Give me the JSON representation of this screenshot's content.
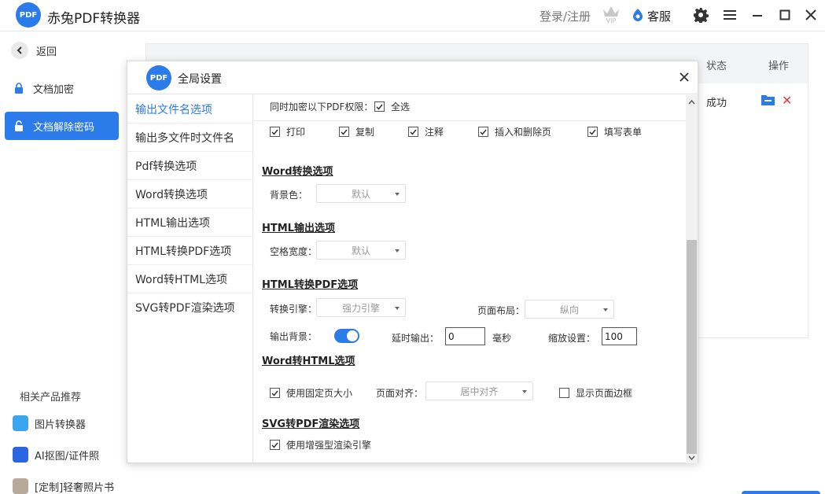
{
  "titlebar": {
    "logo_text": "PDF",
    "app_title": "赤兔PDF转换器",
    "login_label": "登录/注册",
    "vip_icon": "vip-crown-icon",
    "service_label": "客服"
  },
  "sidebar": {
    "back_label": "返回",
    "items": [
      {
        "label": "文档加密",
        "icon": "lock-icon",
        "active": false
      },
      {
        "label": "文档解除密码",
        "icon": "unlock-icon",
        "active": true
      }
    ],
    "related_title": "相关产品推荐",
    "products": [
      {
        "label": "图片转换器",
        "color": "#3aa6f0"
      },
      {
        "label": "AI抠图/证件照",
        "color": "#2b66e0"
      },
      {
        "label": "[定制]轻奢照片书",
        "color": "#b9a99a"
      }
    ]
  },
  "background_table": {
    "status_header": "状态",
    "action_header": "操作",
    "rows": [
      {
        "status": "成功"
      }
    ]
  },
  "dialog": {
    "logo_text": "PDF",
    "title": "全局设置",
    "menu": [
      {
        "label": "输出文件名选项",
        "active": true
      },
      {
        "label": "输出多文件时文件名",
        "active": false
      },
      {
        "label": "Pdf转换选项",
        "active": false
      },
      {
        "label": "Word转换选项",
        "active": false
      },
      {
        "label": "HTML输出选项",
        "active": false
      },
      {
        "label": "HTML转换PDF选项",
        "active": false
      },
      {
        "label": "Word转HTML选项",
        "active": false
      },
      {
        "label": "SVG转PDF渲染选项",
        "active": false
      }
    ],
    "permissions": {
      "label": "同时加密以下PDF权限：",
      "select_all": "全选",
      "items": [
        "打印",
        "复制",
        "注释",
        "插入和删除页",
        "填写表单"
      ]
    },
    "word_section": {
      "title": "Word转换选项",
      "bg_color_label": "背景色：",
      "bg_color_value": "默认"
    },
    "html_output_section": {
      "title": "HTML输出选项",
      "space_width_label": "空格宽度：",
      "space_width_value": "默认"
    },
    "html_to_pdf_section": {
      "title": "HTML转换PDF选项",
      "engine_label": "转换引擎：",
      "engine_value": "强力引擎",
      "layout_label": "页面布局：",
      "layout_value": "纵向",
      "output_bg_label": "输出背景：",
      "output_bg_on": true,
      "delay_label": "延时输出：",
      "delay_value": "0",
      "delay_unit": "毫秒",
      "zoom_label": "缩放设置：",
      "zoom_value": "100"
    },
    "word_to_html_section": {
      "title": "Word转HTML选项",
      "fixed_size_label": "使用固定页大小",
      "align_label": "页面对齐：",
      "align_value": "居中对齐",
      "show_border_label": "显示页面边框"
    },
    "svg_section": {
      "title": "SVG转PDF渲染选项",
      "enhanced_label": "使用增强型渲染引擎"
    }
  }
}
